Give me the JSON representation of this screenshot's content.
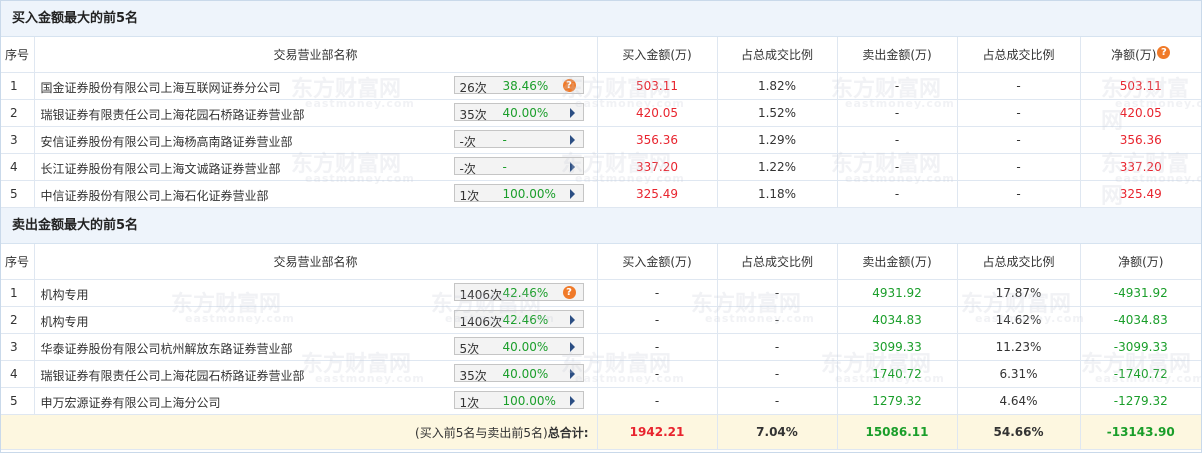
{
  "buy_section": {
    "title": "买入金额最大的前5名",
    "headers": {
      "idx": "序号",
      "dept": "交易营业部名称",
      "buy": "买入金额(万)",
      "buy_ratio": "占总成交比例",
      "sell": "卖出金额(万)",
      "sell_ratio": "占总成交比例",
      "net": "净额(万)"
    },
    "rows": [
      {
        "idx": "1",
        "name": "国金证券股份有限公司上海互联网证券分公司",
        "count": "26次",
        "pct": "38.46%",
        "icon": "question-icon",
        "buy": "503.11",
        "buy_ratio": "1.82%",
        "sell": "-",
        "sell_ratio": "-",
        "net": "503.11"
      },
      {
        "idx": "2",
        "name": "瑞银证券有限责任公司上海花园石桥路证券营业部",
        "count": "35次",
        "pct": "40.00%",
        "icon": "arrow-right-icon",
        "buy": "420.05",
        "buy_ratio": "1.52%",
        "sell": "-",
        "sell_ratio": "-",
        "net": "420.05"
      },
      {
        "idx": "3",
        "name": "安信证券股份有限公司上海杨高南路证券营业部",
        "count": "-次",
        "pct": "-",
        "icon": "arrow-right-icon",
        "buy": "356.36",
        "buy_ratio": "1.29%",
        "sell": "-",
        "sell_ratio": "-",
        "net": "356.36"
      },
      {
        "idx": "4",
        "name": "长江证券股份有限公司上海文诚路证券营业部",
        "count": "-次",
        "pct": "-",
        "icon": "arrow-right-icon",
        "buy": "337.20",
        "buy_ratio": "1.22%",
        "sell": "-",
        "sell_ratio": "-",
        "net": "337.20"
      },
      {
        "idx": "5",
        "name": "中信证券股份有限公司上海石化证券营业部",
        "count": "1次",
        "pct": "100.00%",
        "icon": "arrow-right-icon",
        "buy": "325.49",
        "buy_ratio": "1.18%",
        "sell": "-",
        "sell_ratio": "-",
        "net": "325.49"
      }
    ]
  },
  "sell_section": {
    "title": "卖出金额最大的前5名",
    "headers": {
      "idx": "序号",
      "dept": "交易营业部名称",
      "buy": "买入金额(万)",
      "buy_ratio": "占总成交比例",
      "sell": "卖出金额(万)",
      "sell_ratio": "占总成交比例",
      "net": "净额(万)"
    },
    "rows": [
      {
        "idx": "1",
        "name": "机构专用",
        "count": "1406次",
        "pct": "42.46%",
        "icon": "question-icon",
        "buy": "-",
        "buy_ratio": "-",
        "sell": "4931.92",
        "sell_ratio": "17.87%",
        "net": "-4931.92"
      },
      {
        "idx": "2",
        "name": "机构专用",
        "count": "1406次",
        "pct": "42.46%",
        "icon": "arrow-right-icon",
        "buy": "-",
        "buy_ratio": "-",
        "sell": "4034.83",
        "sell_ratio": "14.62%",
        "net": "-4034.83"
      },
      {
        "idx": "3",
        "name": "华泰证券股份有限公司杭州解放东路证券营业部",
        "count": "5次",
        "pct": "40.00%",
        "icon": "arrow-right-icon",
        "buy": "-",
        "buy_ratio": "-",
        "sell": "3099.33",
        "sell_ratio": "11.23%",
        "net": "-3099.33"
      },
      {
        "idx": "4",
        "name": "瑞银证券有限责任公司上海花园石桥路证券营业部",
        "count": "35次",
        "pct": "40.00%",
        "icon": "arrow-right-icon",
        "buy": "-",
        "buy_ratio": "-",
        "sell": "1740.72",
        "sell_ratio": "6.31%",
        "net": "-1740.72"
      },
      {
        "idx": "5",
        "name": "申万宏源证券有限公司上海分公司",
        "count": "1次",
        "pct": "100.00%",
        "icon": "arrow-right-icon",
        "buy": "-",
        "buy_ratio": "-",
        "sell": "1279.32",
        "sell_ratio": "4.64%",
        "net": "-1279.32"
      }
    ]
  },
  "total": {
    "label_prefix": "(买入前5名与卖出前5名)",
    "label_strong": "总合计:",
    "buy": "1942.21",
    "buy_ratio": "7.04%",
    "sell": "15086.11",
    "sell_ratio": "54.66%",
    "net": "-13143.90"
  },
  "watermark": {
    "text": "东方财富网",
    "sub": "eastmoney.com"
  },
  "colors": {
    "buy": "#e8242e",
    "sell": "#1a9e2a",
    "header_bg": "#eef4fb",
    "total_bg": "#fdf7e0",
    "icon_orange": "#f07a29",
    "arrow": "#2b4e83"
  }
}
